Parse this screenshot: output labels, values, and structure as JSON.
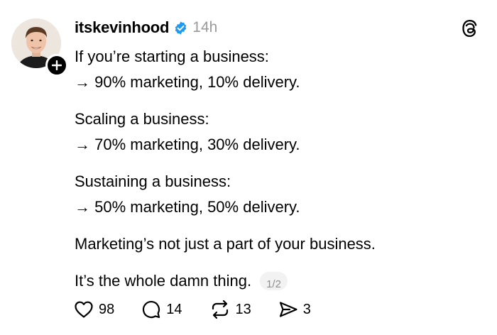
{
  "post": {
    "username": "itskevinhood",
    "time": "14h",
    "paragraphs": [
      [
        "If you’re starting a business:",
        "→ 90% marketing, 10% delivery."
      ],
      [
        "Scaling a business:",
        "→ 70% marketing, 30% delivery."
      ],
      [
        "Sustaining a business:",
        "→ 50% marketing, 50% delivery."
      ],
      [
        "Marketing’s not just a part of your business."
      ]
    ],
    "last_line": "It’s the whole damn thing.",
    "page_indicator": "1/2"
  },
  "actions": {
    "likes": "98",
    "comments": "14",
    "reposts": "13",
    "shares": "3"
  },
  "colors": {
    "verified": "#1d9bf0",
    "muted": "#9a9a9a",
    "pill_bg": "#f2f2f2"
  },
  "icons": [
    "plus-icon",
    "verified-badge-icon",
    "threads-logo-icon",
    "heart-icon",
    "comment-icon",
    "repost-icon",
    "share-icon"
  ]
}
